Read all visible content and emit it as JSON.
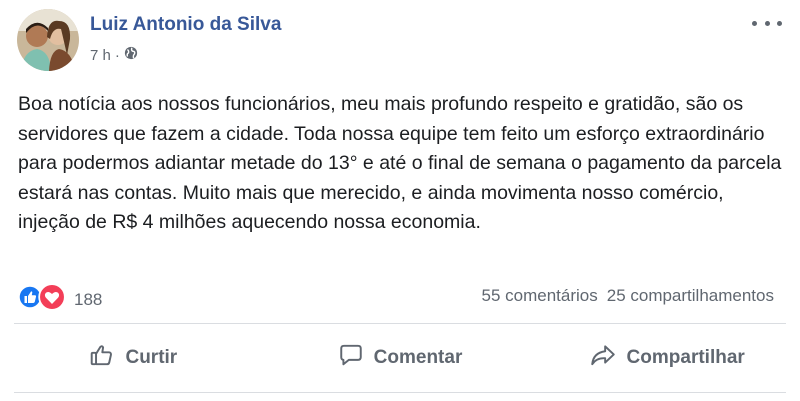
{
  "post": {
    "author": "Luiz Antonio da Silva",
    "time": "7 h",
    "time_separator": "·",
    "audience_icon": "globe-icon",
    "text": "Boa notícia aos nossos funcionários, meu mais profundo respeito e gratidão, são os servidores que fazem a cidade. Toda nossa equipe tem feito um esforço extraordinário para podermos adiantar metade do 13° e até o final de semana o pagamento da parcela estará nas contas. Muito mais que merecido, e ainda movimenta nosso comércio, injeção de R$ 4 milhões aquecendo nossa economia."
  },
  "reactions": {
    "icons": [
      "like-reaction-icon",
      "love-reaction-icon"
    ],
    "count": "188",
    "comments": "55 comentários",
    "shares": "25 compartilhamentos"
  },
  "actions": {
    "like": "Curtir",
    "comment": "Comentar",
    "share": "Compartilhar"
  },
  "colors": {
    "author": "#385898",
    "like_blue": "#1877f2",
    "love_red": "#f33e58",
    "muted": "#606770"
  }
}
